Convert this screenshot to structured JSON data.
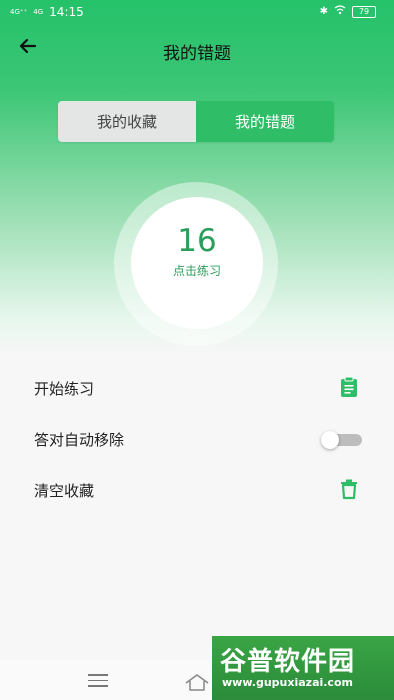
{
  "status_bar": {
    "signal_1": "4G⁺⁺",
    "signal_2": "4G",
    "time": "14:15",
    "battery": "79"
  },
  "header": {
    "title": "我的错题"
  },
  "tabs": {
    "favorites": "我的收藏",
    "mistakes": "我的错题",
    "active": "mistakes"
  },
  "summary": {
    "count": "16",
    "action": "点击练习"
  },
  "options": {
    "start_practice": "开始练习",
    "auto_remove": "答对自动移除",
    "auto_remove_on": false,
    "clear": "清空收藏"
  },
  "watermark": {
    "brand": "谷普软件园",
    "url": "www.gupuxiazai.com"
  },
  "colors": {
    "accent": "#2fbd67",
    "accent_dark": "#2a9e5a",
    "header_green": "#25c26a"
  }
}
